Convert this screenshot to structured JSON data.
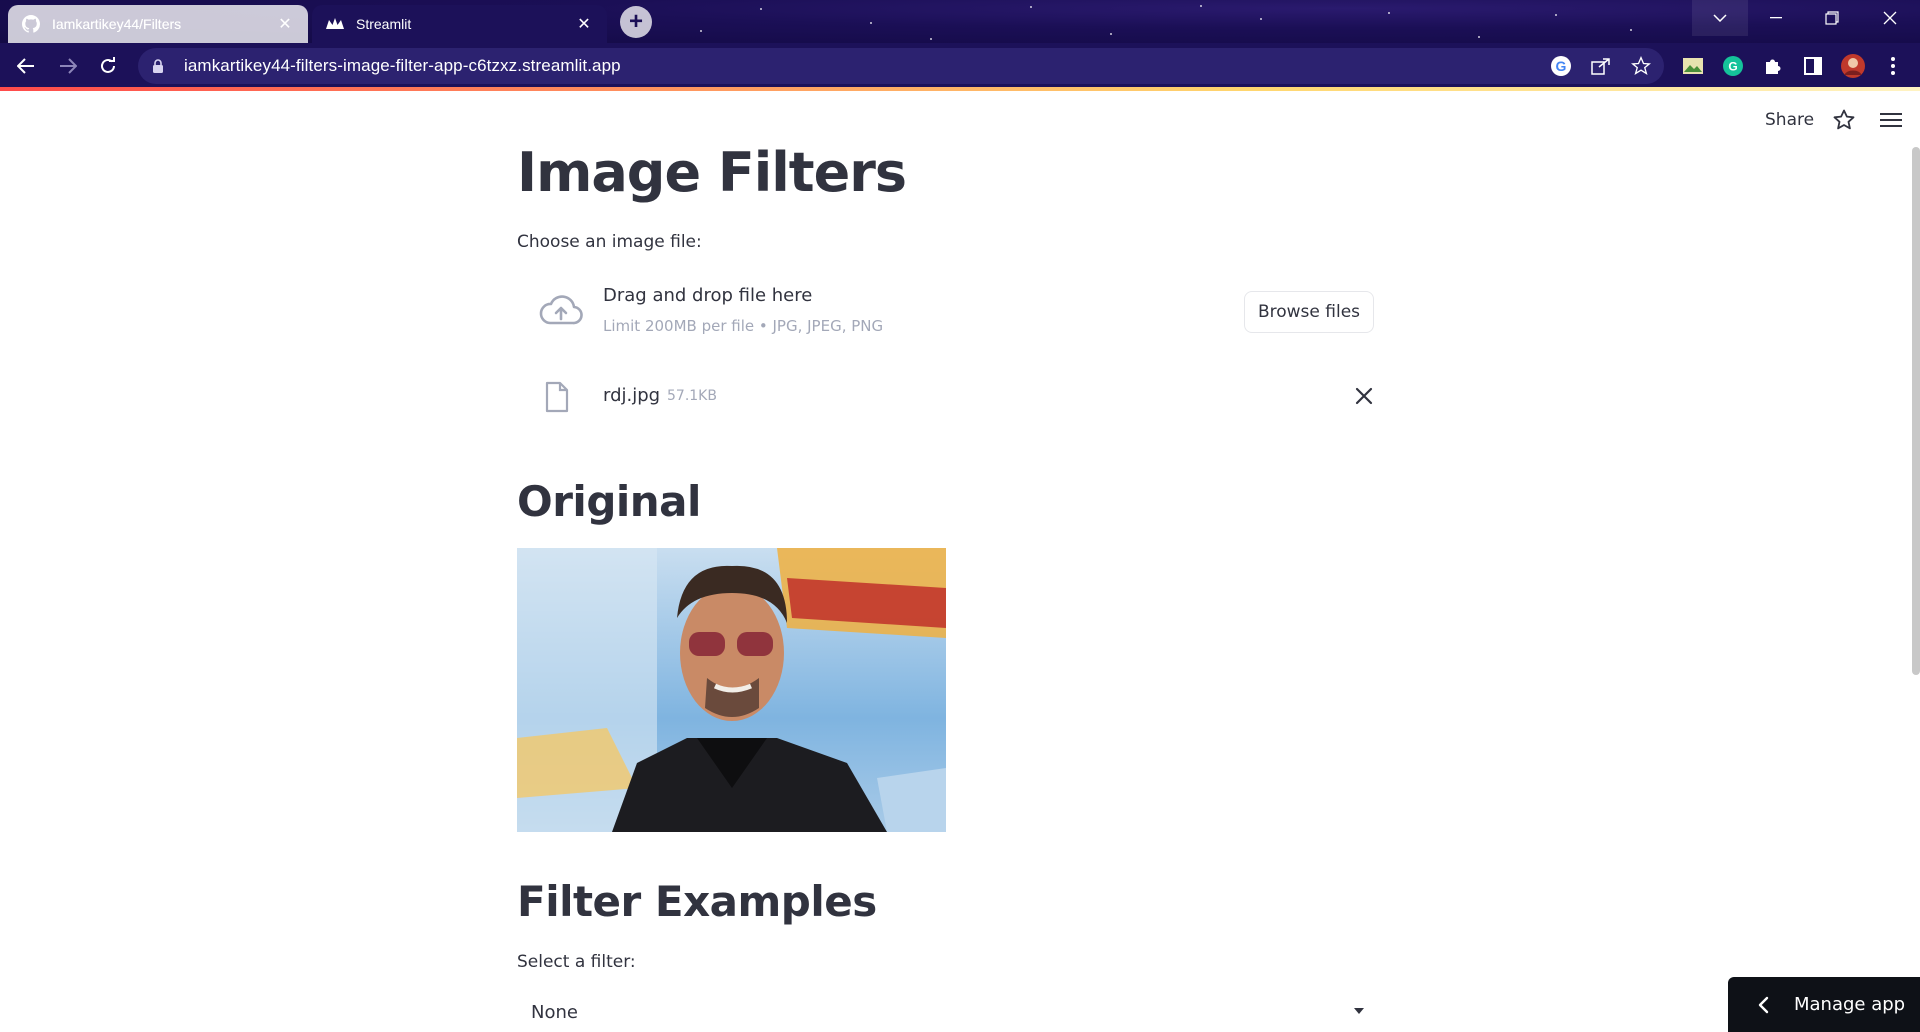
{
  "browser": {
    "tabs": [
      {
        "title": "Iamkartikey44/Filters",
        "favicon": "github-icon",
        "active": false
      },
      {
        "title": "Streamlit",
        "favicon": "streamlit-icon",
        "active": true
      }
    ],
    "url": "iamkartikey44-filters-image-filter-app-c6tzxz.streamlit.app",
    "theme_color": "#1c1159"
  },
  "app": {
    "header": {
      "share_label": "Share"
    },
    "title": "Image Filters",
    "uploader": {
      "label": "Choose an image file:",
      "drop_text": "Drag and drop file here",
      "limit_text": "Limit 200MB per file • JPG, JPEG, PNG",
      "browse_label": "Browse files"
    },
    "uploaded_file": {
      "name": "rdj.jpg",
      "size": "57.1KB"
    },
    "original_heading": "Original",
    "examples_heading": "Filter Examples",
    "filter_select": {
      "label": "Select a filter:",
      "value": "None"
    },
    "manage_app_label": "Manage app",
    "accent_color": "#ff4b4b"
  }
}
